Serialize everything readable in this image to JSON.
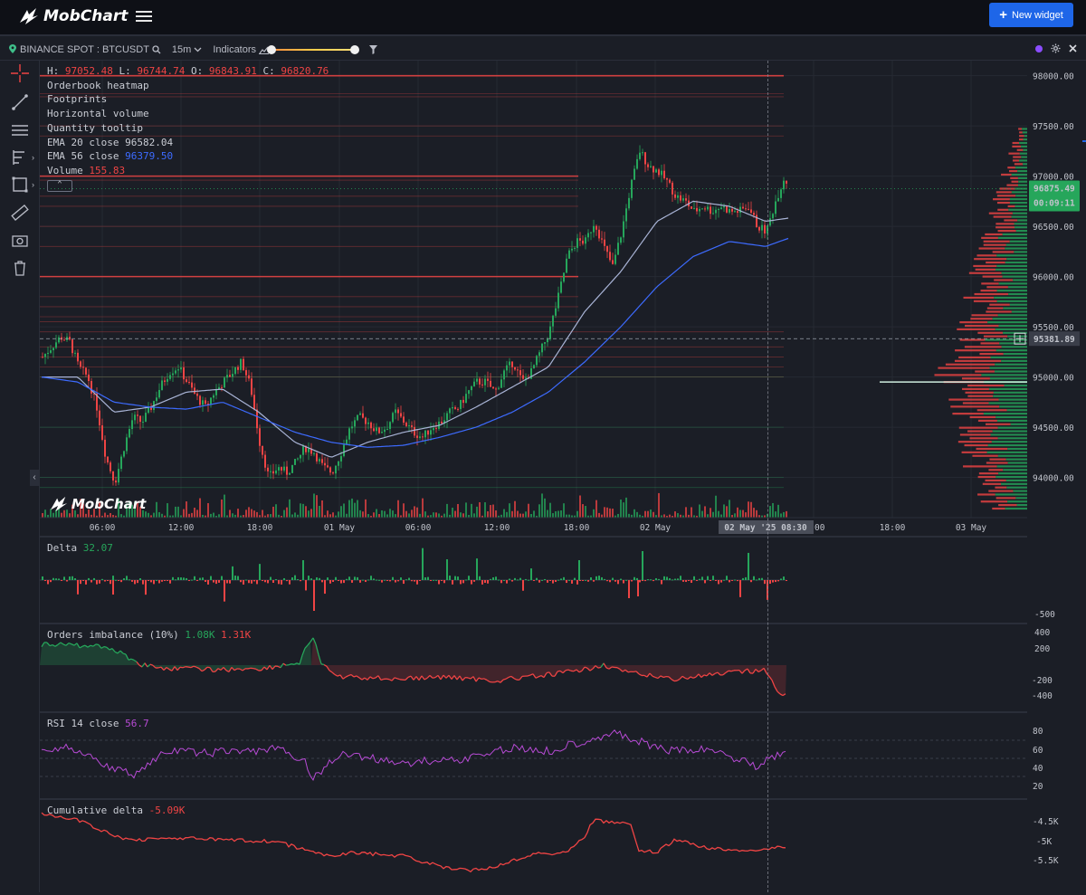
{
  "app": {
    "name": "MobChart",
    "new_widget_label": "New widget"
  },
  "toolbar": {
    "exchange": "BINANCE SPOT",
    "symbol": "BTCUSDT",
    "timeframe": "15m",
    "indicators_label": "Indicators"
  },
  "legend": {
    "ohlc": {
      "h_label": "H:",
      "h": "97052.48",
      "l_label": "L:",
      "l": "96744.74",
      "o_label": "O:",
      "o": "96843.91",
      "c_label": "C:",
      "c": "96820.76"
    },
    "items": [
      "Orderbook heatmap",
      "Footprints",
      "Horizontal volume",
      "Quantity tooltip"
    ],
    "ema20": {
      "label": "EMA 20 close",
      "value": "96582.04",
      "color": "#a9b4d6"
    },
    "ema56": {
      "label": "EMA 56 close",
      "value": "96379.50",
      "color": "#3d6bff"
    },
    "volume": {
      "label": "Volume",
      "value": "155.83"
    }
  },
  "price_axis": {
    "ticks": [
      "98000.00",
      "97500.00",
      "97000.00",
      "96500.00",
      "96000.00",
      "95500.00",
      "95000.00",
      "94500.00",
      "94000.00"
    ],
    "last_price": "96875.49",
    "countdown": "00:09:11",
    "crosshair_price": "95381.89"
  },
  "time_axis": {
    "ticks": [
      "06:00",
      "12:00",
      "18:00",
      "01 May",
      "06:00",
      "12:00",
      "18:00",
      "02 May",
      "18:00",
      "03 May"
    ],
    "crosshair_label": "02 May '25   08:30",
    "partial_tick": "00"
  },
  "delta": {
    "label": "Delta",
    "value": "32.07",
    "axis": [
      "-500"
    ]
  },
  "orders_imbalance": {
    "label": "Orders imbalance (10%)",
    "value1": "1.08K",
    "value2": "1.31K",
    "axis": [
      "400",
      "200",
      "-200",
      "-400"
    ]
  },
  "rsi": {
    "label": "RSI 14 close",
    "value": "56.7",
    "axis": [
      "80",
      "60",
      "40",
      "20"
    ]
  },
  "cumdelta": {
    "label": "Cumulative delta",
    "value": "-5.09K",
    "axis": [
      "-4.5K",
      "-5K",
      "-5.5K"
    ]
  },
  "watermark": "MobChart",
  "colors": {
    "up": "#26a65b",
    "down": "#ef4444",
    "accent": "#1e66e8",
    "bg": "#1b1e26"
  },
  "chart_data": {
    "type": "line",
    "symbol": "BTCUSDT",
    "interval": "15m",
    "ylim": [
      93600,
      98150
    ],
    "series": [
      {
        "name": "EMA 20 close",
        "last": 96582.04
      },
      {
        "name": "EMA 56 close",
        "last": 96379.5
      }
    ],
    "close_path": [
      [
        0,
        95200
      ],
      [
        10,
        95300
      ],
      [
        20,
        95400
      ],
      [
        30,
        95350
      ],
      [
        40,
        95100
      ],
      [
        50,
        95000
      ],
      [
        60,
        94700
      ],
      [
        70,
        94200
      ],
      [
        80,
        93950
      ],
      [
        90,
        94300
      ],
      [
        100,
        94600
      ],
      [
        110,
        94550
      ],
      [
        120,
        94700
      ],
      [
        130,
        94900
      ],
      [
        140,
        95050
      ],
      [
        150,
        95100
      ],
      [
        160,
        94950
      ],
      [
        170,
        94800
      ],
      [
        180,
        94700
      ],
      [
        190,
        94850
      ],
      [
        200,
        94950
      ],
      [
        210,
        95050
      ],
      [
        220,
        95150
      ],
      [
        230,
        94900
      ],
      [
        240,
        94350
      ],
      [
        250,
        94000
      ],
      [
        260,
        94100
      ],
      [
        270,
        94050
      ],
      [
        280,
        94150
      ],
      [
        290,
        94300
      ],
      [
        300,
        94250
      ],
      [
        310,
        94100
      ],
      [
        320,
        94050
      ],
      [
        330,
        94250
      ],
      [
        340,
        94500
      ],
      [
        350,
        94600
      ],
      [
        360,
        94550
      ],
      [
        370,
        94450
      ],
      [
        380,
        94500
      ],
      [
        390,
        94650
      ],
      [
        400,
        94550
      ],
      [
        410,
        94450
      ],
      [
        420,
        94400
      ],
      [
        430,
        94500
      ],
      [
        440,
        94550
      ],
      [
        450,
        94650
      ],
      [
        460,
        94700
      ],
      [
        470,
        94850
      ],
      [
        480,
        94950
      ],
      [
        490,
        94950
      ],
      [
        500,
        94850
      ],
      [
        510,
        95050
      ],
      [
        520,
        95150
      ],
      [
        530,
        94950
      ],
      [
        540,
        95050
      ],
      [
        550,
        95250
      ],
      [
        560,
        95450
      ],
      [
        570,
        95800
      ],
      [
        580,
        96200
      ],
      [
        590,
        96350
      ],
      [
        600,
        96350
      ],
      [
        610,
        96550
      ],
      [
        620,
        96300
      ],
      [
        630,
        96100
      ],
      [
        640,
        96450
      ],
      [
        650,
        96900
      ],
      [
        660,
        97250
      ],
      [
        670,
        97100
      ],
      [
        680,
        97050
      ],
      [
        690,
        96950
      ],
      [
        700,
        96800
      ],
      [
        710,
        96750
      ],
      [
        720,
        96650
      ],
      [
        730,
        96700
      ],
      [
        740,
        96650
      ],
      [
        750,
        96700
      ],
      [
        760,
        96650
      ],
      [
        770,
        96650
      ],
      [
        780,
        96700
      ],
      [
        790,
        96500
      ],
      [
        800,
        96450
      ],
      [
        810,
        96750
      ],
      [
        820,
        97000
      ],
      [
        825,
        96875
      ]
    ],
    "ema20_path": [
      [
        0,
        95000
      ],
      [
        40,
        95000
      ],
      [
        80,
        94650
      ],
      [
        120,
        94700
      ],
      [
        160,
        94850
      ],
      [
        200,
        94880
      ],
      [
        240,
        94650
      ],
      [
        280,
        94350
      ],
      [
        320,
        94200
      ],
      [
        360,
        94350
      ],
      [
        400,
        94450
      ],
      [
        440,
        94520
      ],
      [
        480,
        94700
      ],
      [
        520,
        94900
      ],
      [
        560,
        95100
      ],
      [
        600,
        95650
      ],
      [
        640,
        96050
      ],
      [
        680,
        96550
      ],
      [
        720,
        96750
      ],
      [
        760,
        96700
      ],
      [
        800,
        96550
      ],
      [
        825,
        96582
      ]
    ],
    "ema56_path": [
      [
        0,
        95000
      ],
      [
        40,
        94950
      ],
      [
        80,
        94750
      ],
      [
        120,
        94700
      ],
      [
        160,
        94680
      ],
      [
        200,
        94750
      ],
      [
        240,
        94600
      ],
      [
        280,
        94450
      ],
      [
        320,
        94350
      ],
      [
        360,
        94300
      ],
      [
        400,
        94320
      ],
      [
        440,
        94400
      ],
      [
        480,
        94500
      ],
      [
        520,
        94650
      ],
      [
        560,
        94850
      ],
      [
        600,
        95150
      ],
      [
        640,
        95500
      ],
      [
        680,
        95900
      ],
      [
        720,
        96200
      ],
      [
        760,
        96350
      ],
      [
        800,
        96300
      ],
      [
        825,
        96380
      ]
    ],
    "delta_value": 32.07,
    "orders_imbalance_values": [
      1080,
      1310
    ],
    "rsi_value": 56.7,
    "cumulative_delta_value": -5090
  }
}
